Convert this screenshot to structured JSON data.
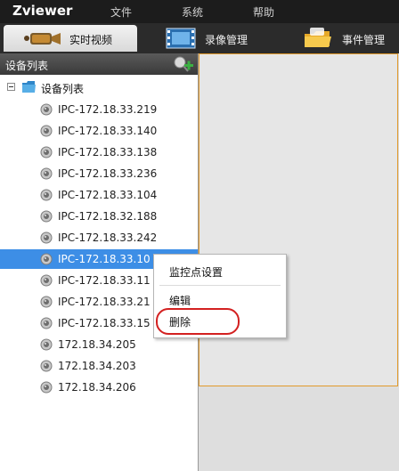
{
  "app": {
    "title": "Zviewer"
  },
  "menu": [
    "文件",
    "系统",
    "帮助"
  ],
  "tabs": [
    {
      "label": "实时视频",
      "active": true,
      "icon": "camera-icon"
    },
    {
      "label": "录像管理",
      "active": false,
      "icon": "film-icon"
    },
    {
      "label": "事件管理",
      "active": false,
      "icon": "folder-icon"
    }
  ],
  "device_panel": {
    "title": "设备列表",
    "add_icon": "add-device-icon",
    "root_label": "设备列表",
    "devices": [
      "IPC-172.18.33.219",
      "IPC-172.18.33.140",
      "IPC-172.18.33.138",
      "IPC-172.18.33.236",
      "IPC-172.18.33.104",
      "IPC-172.18.32.188",
      "IPC-172.18.33.242",
      "IPC-172.18.33.10",
      "IPC-172.18.33.11",
      "IPC-172.18.33.21",
      "IPC-172.18.33.15",
      "172.18.34.205",
      "172.18.34.203",
      "172.18.34.206"
    ],
    "selected_index": 7
  },
  "context_menu": {
    "items": [
      "监控点设置",
      "编辑",
      "删除"
    ],
    "highlighted": "删除"
  },
  "colors": {
    "selection": "#3d8ee6",
    "highlight_oval": "#d32020",
    "viewport_border": "#e19a2c"
  }
}
